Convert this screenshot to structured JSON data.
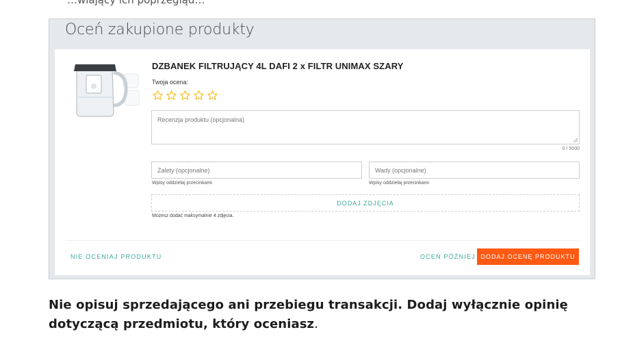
{
  "top_text": "…wiający ich poprzegląd…",
  "panel": {
    "title": "Oceń zakupione produkty"
  },
  "product": {
    "name": "DZBANEK FILTRUJĄCY 4L DAFI 2 x FILTR UNIMAX SZARY",
    "image_icon": "water-pitcher-with-filters",
    "rating_label": "Twoja ocena:",
    "stars_total": 5,
    "stars_selected": 0,
    "star_color": "#f2b400"
  },
  "review": {
    "placeholder": "Recenzja produktu (opcjonalna)",
    "counter": "0 / 5000"
  },
  "pros": {
    "placeholder": "Zalety (opcjonalne)",
    "hint": "Wpisy oddzielaj przecinkami"
  },
  "cons": {
    "placeholder": "Wady (opcjonalne)",
    "hint": "Wpisy oddzielaj przecinkami"
  },
  "photos": {
    "button_label": "DODAJ ZDJĘCIA",
    "hint": "Możesz dodać maksymalnie 4 zdjęcia."
  },
  "actions": {
    "skip_label": "NIE OCENIAJ PRODUKTU",
    "later_label": "OCEŃ PÓŹNIEJ",
    "submit_label": "DODAJ OCENĘ PRODUKTU"
  },
  "colors": {
    "accent_teal": "#3aa897",
    "submit_orange": "#ff5a14"
  },
  "notice": {
    "bold_text": "Nie opisuj sprzedającego ani przebiegu transakcji. Dodaj wyłącznie opinię dotyczącą przedmiotu, który oceniasz",
    "trailing": "."
  }
}
